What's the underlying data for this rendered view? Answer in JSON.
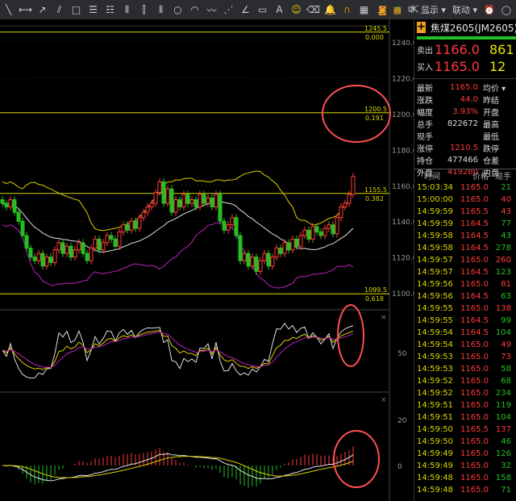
{
  "toolbar": {
    "icons": [
      "line-tool",
      "horizontal-line",
      "arrow-line",
      "parallel-line",
      "rectangle",
      "fib-box",
      "fib-box-2",
      "vertical-lines",
      "fib-lines",
      "time-lines",
      "circle",
      "arc",
      "wave",
      "fan",
      "angle",
      "ruler",
      "text",
      "emoji",
      "eraser",
      "alert-bell",
      "magnet",
      "grid-tool",
      "split-tool",
      "tree",
      "export"
    ],
    "more": "…",
    "display_label": "显示",
    "link_label": "联动"
  },
  "colors": {
    "up": "#ff3b3b",
    "down": "#22c022",
    "ma1": "#e0d000",
    "ma2": "#e0e0e0",
    "ma3": "#c020c0",
    "fib": "#d8d800",
    "annotation": "#ff5050"
  },
  "chart": {
    "price_axis": [
      "1240.0",
      "1220.0",
      "1200.0",
      "1180.0",
      "1160.0",
      "1140.0",
      "1120.0",
      "1100.0"
    ],
    "fib_levels": [
      {
        "price": "1245.5",
        "ratio": "0.000",
        "v": 1245.5
      },
      {
        "price": "1200.5",
        "ratio": "0.191",
        "v": 1200.5
      },
      {
        "price": "1155.5",
        "ratio": "0.382",
        "v": 1155.5
      },
      {
        "price": "1099.5",
        "ratio": "0.618",
        "v": 1099.5
      }
    ],
    "closes": [
      1150,
      1148,
      1152,
      1145,
      1140,
      1132,
      1125,
      1120,
      1118,
      1122,
      1115,
      1120,
      1117,
      1124,
      1128,
      1122,
      1126,
      1120,
      1124,
      1128,
      1122,
      1118,
      1125,
      1130,
      1124,
      1128,
      1132,
      1130,
      1126,
      1134,
      1138,
      1135,
      1140,
      1136,
      1142,
      1145,
      1148,
      1150,
      1156,
      1162,
      1150,
      1158,
      1145,
      1152,
      1148,
      1155,
      1150,
      1152,
      1148,
      1155,
      1150,
      1153,
      1148,
      1155,
      1140,
      1135,
      1138,
      1142,
      1132,
      1118,
      1122,
      1115,
      1120,
      1112,
      1118,
      1122,
      1115,
      1120,
      1125,
      1122,
      1128,
      1124,
      1130,
      1126,
      1132,
      1135,
      1130,
      1137,
      1134,
      1132,
      1136,
      1138,
      1133,
      1142,
      1148,
      1150,
      1155,
      1165
    ],
    "sub1_axis": "50",
    "sub2_axis": [
      "20",
      "0"
    ]
  },
  "panel": {
    "title": "焦煤2605(JM2605)",
    "ask": {
      "label": "卖出",
      "price": "1166.0",
      "vol": "861"
    },
    "bid": {
      "label": "买入",
      "price": "1165.0",
      "vol": "12"
    },
    "info": [
      {
        "a": "最新",
        "b": "1165.0",
        "bc": "red",
        "c": "均价 ▾"
      },
      {
        "a": "涨跌",
        "b": "44.0",
        "bc": "red",
        "c": "昨结"
      },
      {
        "a": "幅度",
        "b": "3.93%",
        "bc": "red",
        "c": "开盘"
      },
      {
        "a": "总手",
        "b": "822672",
        "bc": "wht",
        "c": "最高"
      },
      {
        "a": "现手",
        "b": "",
        "bc": "wht",
        "c": "最低"
      },
      {
        "a": "涨停",
        "b": "1210.5",
        "bc": "red",
        "c": "跌停"
      },
      {
        "a": "持仓",
        "b": "477466",
        "bc": "wht",
        "c": "仓差"
      },
      {
        "a": "外盘",
        "b": "419280",
        "bc": "red",
        "c": "内盘"
      }
    ],
    "tick_headers": {
      "time": "时间",
      "price": "价格",
      "qty": "现手"
    },
    "ticks": [
      [
        "15:03:34",
        "1165.0",
        "21",
        "grn"
      ],
      [
        "15:00:00",
        "1165.0",
        "40",
        "red"
      ],
      [
        "14:59:59",
        "1165.5",
        "43",
        "red"
      ],
      [
        "14:59:59",
        "1164.5",
        "77",
        "grn"
      ],
      [
        "14:59:58",
        "1164.5",
        "43",
        "grn"
      ],
      [
        "14:59:58",
        "1164.5",
        "278",
        "grn"
      ],
      [
        "14:59:57",
        "1165.0",
        "260",
        "red"
      ],
      [
        "14:59:57",
        "1164.5",
        "123",
        "grn"
      ],
      [
        "14:59:56",
        "1165.0",
        "81",
        "red"
      ],
      [
        "14:59:56",
        "1164.5",
        "63",
        "grn"
      ],
      [
        "14:59:55",
        "1165.0",
        "138",
        "red"
      ],
      [
        "14:59:55",
        "1164.5",
        "99",
        "grn"
      ],
      [
        "14:59:54",
        "1164.5",
        "104",
        "grn"
      ],
      [
        "14:59:54",
        "1165.0",
        "49",
        "red"
      ],
      [
        "14:59:53",
        "1165.0",
        "73",
        "red"
      ],
      [
        "14:59:53",
        "1165.0",
        "58",
        "grn"
      ],
      [
        "14:59:52",
        "1165.0",
        "68",
        "grn"
      ],
      [
        "14:59:52",
        "1165.0",
        "234",
        "grn"
      ],
      [
        "14:59:51",
        "1165.0",
        "119",
        "grn"
      ],
      [
        "14:59:51",
        "1165.0",
        "104",
        "grn"
      ],
      [
        "14:59:50",
        "1165.5",
        "137",
        "red"
      ],
      [
        "14:59:50",
        "1165.0",
        "46",
        "grn"
      ],
      [
        "14:59:49",
        "1165.0",
        "126",
        "grn"
      ],
      [
        "14:59:49",
        "1165.0",
        "32",
        "grn"
      ],
      [
        "14:59:48",
        "1165.0",
        "158",
        "grn"
      ],
      [
        "14:59:48",
        "1165.0",
        "71",
        "grn"
      ]
    ]
  }
}
